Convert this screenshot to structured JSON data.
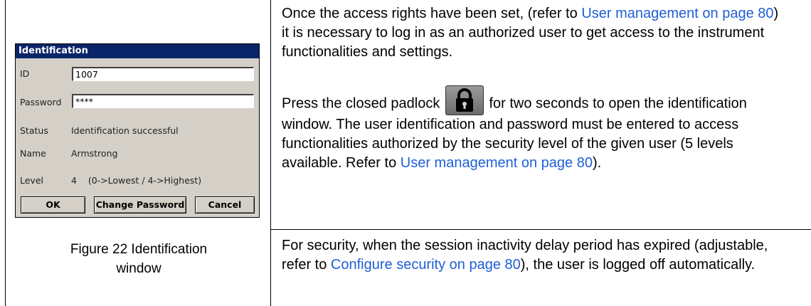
{
  "figure": {
    "dialog": {
      "title": "Identification",
      "id_label": "ID",
      "id_value": "1007",
      "password_label": "Password",
      "password_value": "****",
      "status_label": "Status",
      "status_value": "Identification successful",
      "name_label": "Name",
      "name_value": "Armstrong",
      "level_label": "Level",
      "level_value": "4    (0->Lowest / 4->Highest)",
      "buttons": {
        "ok": "OK",
        "change_password": "Change Password",
        "cancel": "Cancel"
      }
    },
    "caption_line1": "Figure 22  Identification",
    "caption_line2": "window"
  },
  "text": {
    "p1": {
      "t1": "Once the access rights have been set, (refer to ",
      "link1": "User management on page 80",
      "t2": ") it is necessary to log in as an authorized user to get access to the instrument functionalities and settings."
    },
    "p2": {
      "t1": "Press the closed padlock ",
      "t2": " for two seconds to open the identification window. The user identification and password must be entered to access functionalities authorized by the security level of the given user (5 levels available. Refer to ",
      "link1": "User management on page 80",
      "t3": ")."
    },
    "p3": {
      "t1": "For security, when the session inactivity delay period has expired (adjustable, refer to ",
      "link1": "Configure security on page 80",
      "t2": "), the user is logged off automatically."
    }
  },
  "colors": {
    "link": "#1f5fd6",
    "title_bar": "#0a246a",
    "dialog_bg": "#d4d0c8"
  },
  "icons": [
    "padlock-icon"
  ]
}
